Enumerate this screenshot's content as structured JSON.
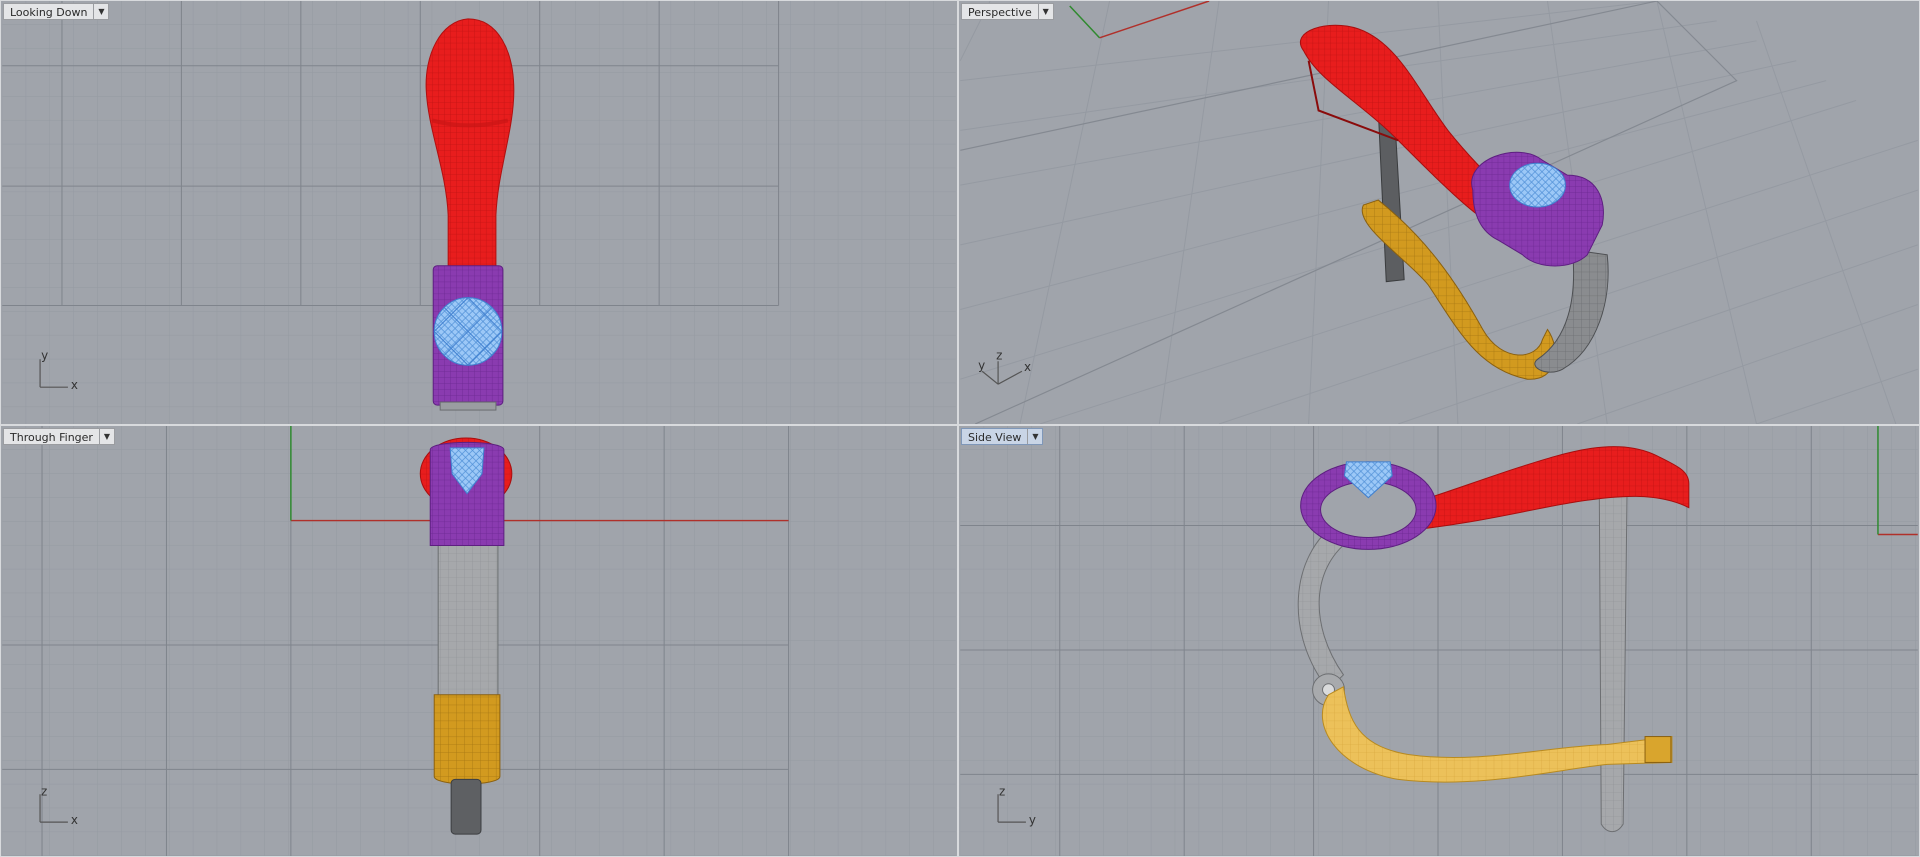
{
  "viewports": [
    {
      "id": "top",
      "title": "Looking Down",
      "active": false,
      "axis_labels": [
        "y",
        "x"
      ]
    },
    {
      "id": "perspective",
      "title": "Perspective",
      "active": false,
      "axis_labels": [
        "y",
        "z",
        "x"
      ]
    },
    {
      "id": "front",
      "title": "Through Finger",
      "active": false,
      "axis_labels": [
        "z",
        "x"
      ]
    },
    {
      "id": "side",
      "title": "Side View",
      "active": true,
      "axis_labels": [
        "z",
        "y"
      ]
    }
  ],
  "icons": {
    "viewport_menu": "dropdown-arrow-icon"
  },
  "colors": {
    "background": "#a0a4ab",
    "grid_minor": "#949aa2",
    "grid_major": "#838891",
    "x_axis": "#b0302a",
    "y_axis": "#2f8a2f",
    "arm_red": "#ec1c1c",
    "clamp_purple": "#8a3bb0",
    "stone_blue": "#8fc0f5",
    "band_gray": "#7b7d80",
    "band_yellow": "#e6ad2a"
  }
}
